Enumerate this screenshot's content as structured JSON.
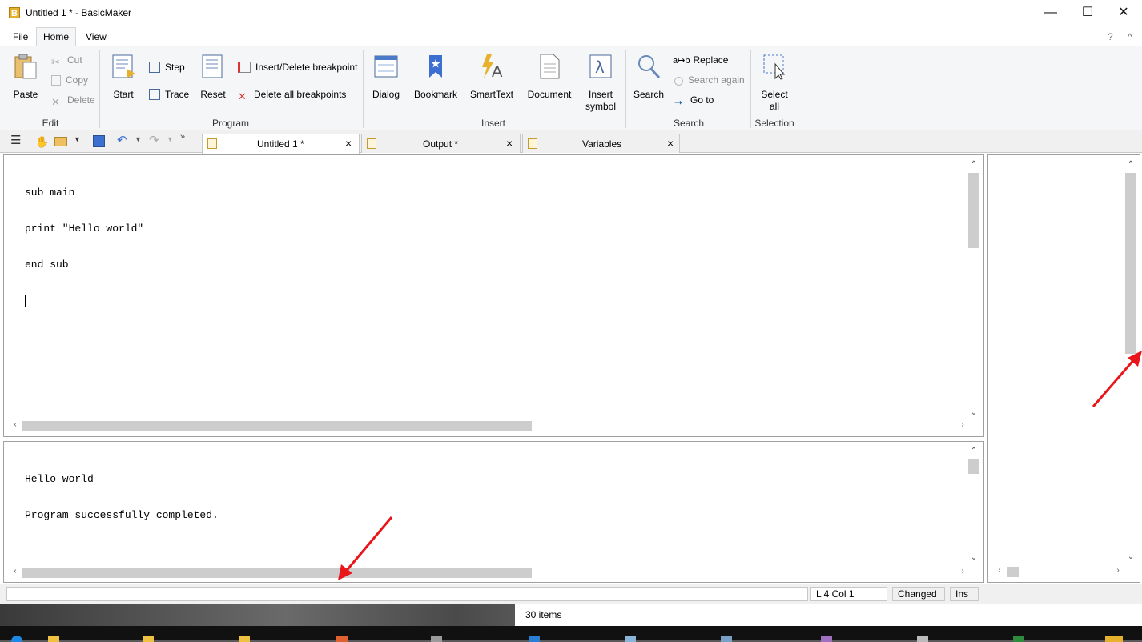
{
  "window": {
    "title": "Untitled 1 * - BasicMaker",
    "app_icon_letter": "B",
    "minimize_glyph": "—",
    "maximize_glyph": "☐",
    "close_glyph": "✕"
  },
  "menu": {
    "items": [
      "File",
      "Home",
      "View"
    ],
    "help_glyph": "?",
    "collapse_glyph": "^"
  },
  "ribbon": {
    "edit": {
      "label": "Edit",
      "paste": "Paste",
      "cut": "Cut",
      "copy": "Copy",
      "delete": "Delete"
    },
    "program": {
      "label": "Program",
      "start": "Start",
      "step": "Step",
      "trace": "Trace",
      "reset": "Reset",
      "insert_delete_breakpoint": "Insert/Delete breakpoint",
      "delete_all_breakpoints": "Delete all breakpoints"
    },
    "insert": {
      "label": "Insert",
      "dialog": "Dialog",
      "bookmark": "Bookmark",
      "smarttext": "SmartText",
      "document": "Document",
      "insert_symbol_line1": "Insert",
      "insert_symbol_line2": "symbol"
    },
    "search": {
      "label": "Search",
      "search": "Search",
      "replace": "Replace",
      "replace_icon_text": "a↦b",
      "search_again": "Search again",
      "go_to": "Go to"
    },
    "selection": {
      "label": "Selection",
      "select_all_line1": "Select",
      "select_all_line2": "all"
    }
  },
  "doc_tabs": [
    {
      "label": "Untitled 1 *",
      "active": true
    },
    {
      "label": "Output *",
      "active": false
    },
    {
      "label": "Variables",
      "active": false
    }
  ],
  "editor": {
    "lines": [
      "sub main",
      "print \"Hello world\"",
      "end sub",
      ""
    ]
  },
  "output": {
    "lines": [
      "Hello world",
      "Program successfully completed."
    ]
  },
  "statusbar": {
    "message": "",
    "position": "L 4 Col 1",
    "changed": "Changed",
    "mode": "Ins"
  },
  "explorer_status": {
    "items": "30 items"
  },
  "colors": {
    "accent_blue": "#2b6cb0",
    "annotation_red": "#e8161b",
    "ribbon_bg": "#f5f6f7"
  }
}
